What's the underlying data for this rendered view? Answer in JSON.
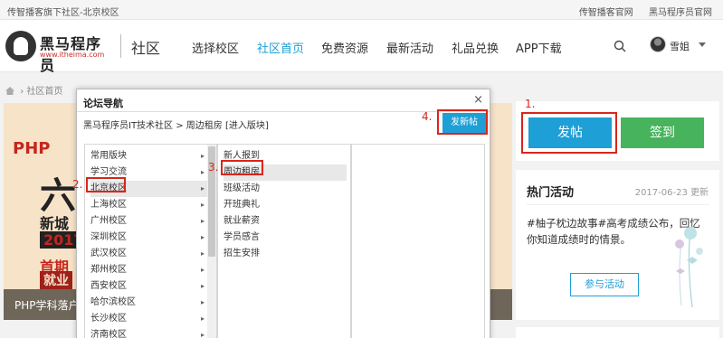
{
  "topbar": {
    "left_text": "传智播客旗下社区-北京校区",
    "links": [
      "传智播客官网",
      "黑马程序员官网"
    ]
  },
  "header": {
    "brand": "黑马程序员",
    "brand_url": "www.itheima.com",
    "section": "社区",
    "nav": [
      {
        "label": "选择校区",
        "active": false
      },
      {
        "label": "社区首页",
        "active": true
      },
      {
        "label": "免费资源",
        "active": false
      },
      {
        "label": "最新活动",
        "active": false
      },
      {
        "label": "礼品兑换",
        "active": false
      },
      {
        "label": "APP下载",
        "active": false
      }
    ],
    "username": "雪姐",
    "icons": {
      "search": "search-icon",
      "user": "avatar"
    }
  },
  "breadcrumb": {
    "current": "社区首页"
  },
  "banner": {
    "lines": [
      "PHP",
      "六",
      "新城",
      "2017",
      "首期",
      "就业"
    ],
    "caption": "PHP学科落户"
  },
  "sidebar": {
    "post_label": "发帖",
    "sign_label": "签到",
    "hot": {
      "title": "热门活动",
      "date": "2017-06-23 更新",
      "text": "#柚子枕边故事#高考成绩公布，回忆你知道成绩时的情景。",
      "join_label": "参与活动"
    }
  },
  "modal": {
    "title": "论坛导航",
    "close": "×",
    "path": "黑马程序员IT技术社区 > 周边租房 [进入版块]",
    "new_post": "发新帖",
    "col1": [
      "常用版块",
      "学习交流",
      "北京校区",
      "上海校区",
      "广州校区",
      "深圳校区",
      "武汉校区",
      "郑州校区",
      "西安校区",
      "哈尔滨校区",
      "长沙校区",
      "济南校区"
    ],
    "col2": [
      "新人报到",
      "周边租房",
      "班级活动",
      "开班典礼",
      "就业薪资",
      "学员感言",
      "招生安排"
    ],
    "col1_selected": "北京校区",
    "col2_selected": "周边租房"
  },
  "annotations": [
    "1.",
    "2.",
    "3.",
    "4."
  ],
  "colors": {
    "accent": "#1e9fd6",
    "green": "#47b35d",
    "annotation": "#d9261c"
  }
}
